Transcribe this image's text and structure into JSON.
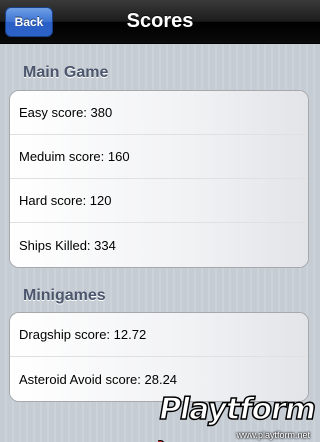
{
  "navbar": {
    "back_label": "Back",
    "title": "Scores"
  },
  "sections": [
    {
      "header": "Main Game",
      "rows": [
        "Easy score: 380",
        "Meduim score: 160",
        "Hard score: 120",
        "Ships Killed: 334"
      ]
    },
    {
      "header": "Minigames",
      "rows": [
        "Dragship score: 12.72",
        "Asteroid Avoid score: 28.24"
      ]
    }
  ],
  "watermark": {
    "logo_text": "Playtform",
    "url": "www.playtform.net"
  },
  "colors": {
    "nav_background": "#1c1c1c",
    "back_button": "#3d72d2",
    "section_header": "#4c566c",
    "table_background": "#c5ccd4"
  }
}
